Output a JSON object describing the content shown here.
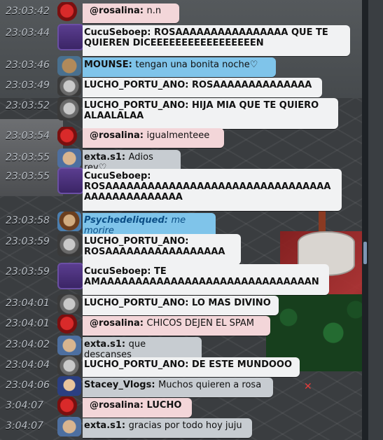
{
  "chat": {
    "messages": [
      {
        "time": "23:03:42",
        "user": "@rosalina:",
        "text": "n.n",
        "style": "pink",
        "avatar": "rose"
      },
      {
        "time": "23:03:44",
        "user": "CucuSeboep:",
        "text": "ROSAAAAAAAAAAAAAAAA QUE TE QUIEREN DICEEEEEEEEEEEEEEEEEN",
        "style": "white",
        "avatar": "cucu"
      },
      {
        "time": "23:03:46",
        "user": "MOUNSE:",
        "text": "tengan una bonita noche♡",
        "style": "blue",
        "avatar": "mounse"
      },
      {
        "time": "23:03:49",
        "user": "LUCHO_PORTU_ANO:",
        "text": "ROSAAAAAAAAAAAAAA",
        "style": "white",
        "avatar": "lucho"
      },
      {
        "time": "23:03:52",
        "user": "LUCHO_PORTU_ANO:",
        "text": "HIJA MIA QUE TE QUIERO ALAALALAA",
        "style": "white",
        "avatar": "lucho"
      },
      {
        "time": "23:03:54",
        "user": "@rosalina:",
        "text": "igualmenteee",
        "style": "pink",
        "avatar": "rose"
      },
      {
        "time": "23:03:55",
        "user": "exta.s1:",
        "text": "Adios rey♡",
        "style": "grey",
        "avatar": "exta"
      },
      {
        "time": "23:03:55",
        "user": "CucuSeboep:",
        "text": "ROSAAAAAAAAAAAAAAAAAAAAAAAAAAAAAAAA AAAAAAAAAAAAAA",
        "style": "white",
        "avatar": "cucu"
      },
      {
        "time": "23:03:58",
        "user": "Psychedeliqued:",
        "text": "me morire",
        "style": "blue",
        "avatar": "psy"
      },
      {
        "time": "23:03:59",
        "user": "LUCHO_PORTU_ANO:",
        "text": "ROSAAAAAAAAAAAAAAAAA",
        "style": "white",
        "avatar": "lucho"
      },
      {
        "time": "23:03:59",
        "user": "CucuSeboep:",
        "text": "TE AMAAAAAAAAAAAAAAAAAAAAAAAAAAAAAAN",
        "style": "white",
        "avatar": "cucu"
      },
      {
        "time": "23:04:01",
        "user": "LUCHO_PORTU_ANO:",
        "text": "LO MAS DIVINO",
        "style": "white",
        "avatar": "lucho"
      },
      {
        "time": "23:04:01",
        "user": "@rosalina:",
        "text": "CHICOS DEJEN EL SPAM",
        "style": "pink",
        "avatar": "rose"
      },
      {
        "time": "23:04:02",
        "user": "exta.s1:",
        "text": "que descanses",
        "style": "grey",
        "avatar": "exta"
      },
      {
        "time": "23:04:04",
        "user": "LUCHO_PORTU_ANO:",
        "text": "DE ESTE MUNDOOO",
        "style": "white",
        "avatar": "lucho"
      },
      {
        "time": "23:04:06",
        "user": "Stacey_Vlogs:",
        "text": "Muchos quieren a rosa",
        "style": "grey",
        "avatar": "stacey"
      },
      {
        "time": "3:04:07",
        "user": "@rosalina:",
        "text": "LUCHO",
        "style": "pink",
        "avatar": "rose"
      },
      {
        "time": "3:04:07",
        "user": "exta.s1:",
        "text": "gracias por todo hoy juju",
        "style": "grey",
        "avatar": "exta"
      }
    ]
  },
  "colors": {
    "white": "#f1f2f3",
    "pink": "#f3d6d9",
    "blue": "#7fc4ea",
    "grey": "#c7ccd1"
  }
}
